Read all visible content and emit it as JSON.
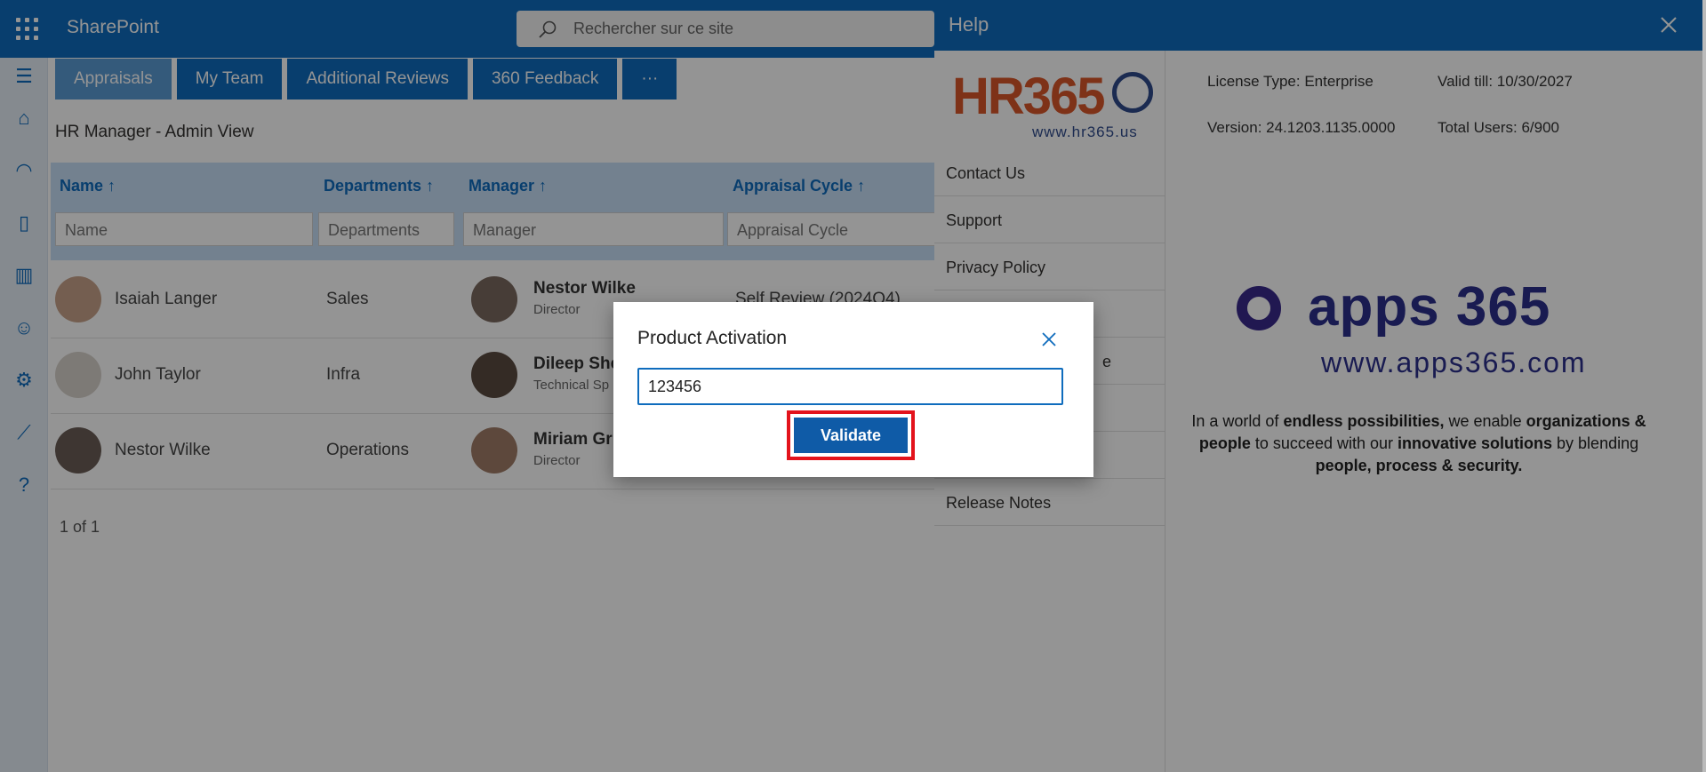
{
  "app": {
    "brand": "SharePoint",
    "search_placeholder": "Rechercher sur ce site"
  },
  "tabs": [
    "Appraisals",
    "My Team",
    "Additional Reviews",
    "360 Feedback",
    "···"
  ],
  "page_title": "HR Manager - Admin View",
  "columns": [
    "Name ↑",
    "Departments ↑",
    "Manager ↑",
    "Appraisal Cycle ↑"
  ],
  "filters": [
    "Name",
    "Departments",
    "Manager",
    "Appraisal Cycle"
  ],
  "rows": [
    {
      "name": "Isaiah Langer",
      "dept": "Sales",
      "manager": "Nestor Wilke",
      "manager_role": "Director",
      "cycle": "Self Review (2024Q4)"
    },
    {
      "name": "John Taylor",
      "dept": "Infra",
      "manager": "Dileep She",
      "manager_role": "Technical Sp",
      "cycle": ""
    },
    {
      "name": "Nestor Wilke",
      "dept": "Operations",
      "manager": "Miriam Gr",
      "manager_role": "Director",
      "cycle": ""
    }
  ],
  "pager": "1 of 1",
  "help": {
    "title": "Help",
    "logo_text": "HR365",
    "logo_url": "www.hr365.us",
    "nav": [
      "Contact Us",
      "Support",
      "Privacy Policy",
      "",
      "e",
      "",
      "",
      "Release Notes"
    ],
    "license": "License Type: Enterprise",
    "valid": "Valid till: 10/30/2027",
    "version": "Version: 24.1203.1135.0000",
    "users": "Total Users: 6/900",
    "apps_logo": "apps 365",
    "apps_url": "www.apps365.com",
    "tagline_parts": [
      "In a world of ",
      "endless possibilities,",
      " we enable ",
      "organizations & people",
      " to succeed with our ",
      "innovative solutions",
      " by blending ",
      "people, process & security."
    ]
  },
  "modal": {
    "title": "Product Activation",
    "value": "123456",
    "button": "Validate"
  },
  "colors": {
    "brand": "#0f6cbd",
    "highlight": "#e3131c"
  }
}
